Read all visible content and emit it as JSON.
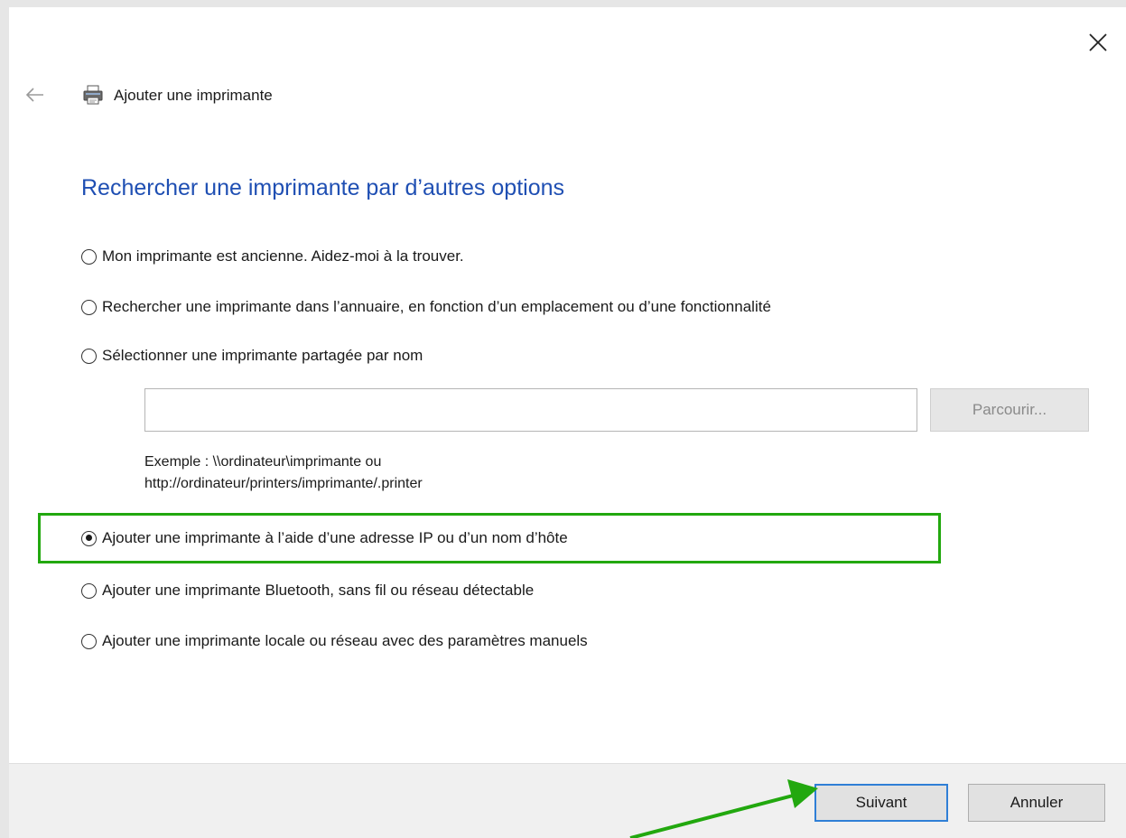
{
  "header": {
    "title": "Ajouter une imprimante",
    "back_icon": "back-arrow-icon",
    "printer_icon": "printer-icon",
    "close_icon": "close-icon"
  },
  "main": {
    "heading": "Rechercher une imprimante par d’autres options",
    "options": [
      {
        "label": "Mon imprimante est ancienne. Aidez-moi à la trouver.",
        "selected": false
      },
      {
        "label": "Rechercher une imprimante dans l’annuaire, en fonction d’un emplacement ou d’une fonctionnalité",
        "selected": false
      },
      {
        "label": "Sélectionner une imprimante partagée par nom",
        "selected": false
      },
      {
        "label": "Ajouter une imprimante à l’aide d’une adresse IP ou d’un nom d’hôte",
        "selected": true
      },
      {
        "label": "Ajouter une imprimante Bluetooth, sans fil ou réseau détectable",
        "selected": false
      },
      {
        "label": "Ajouter une imprimante locale ou réseau avec des paramètres manuels",
        "selected": false
      }
    ],
    "shared_name_input": {
      "value": "",
      "placeholder": ""
    },
    "browse_label": "Parcourir...",
    "example_line1": "Exemple : \\\\ordinateur\\imprimante ou",
    "example_line2": "http://ordinateur/printers/imprimante/.printer"
  },
  "footer": {
    "next_label": "Suivant",
    "cancel_label": "Annuler"
  },
  "colors": {
    "heading": "#1f4fb3",
    "highlight": "#22a80f",
    "next_border": "#2f7fd6"
  }
}
